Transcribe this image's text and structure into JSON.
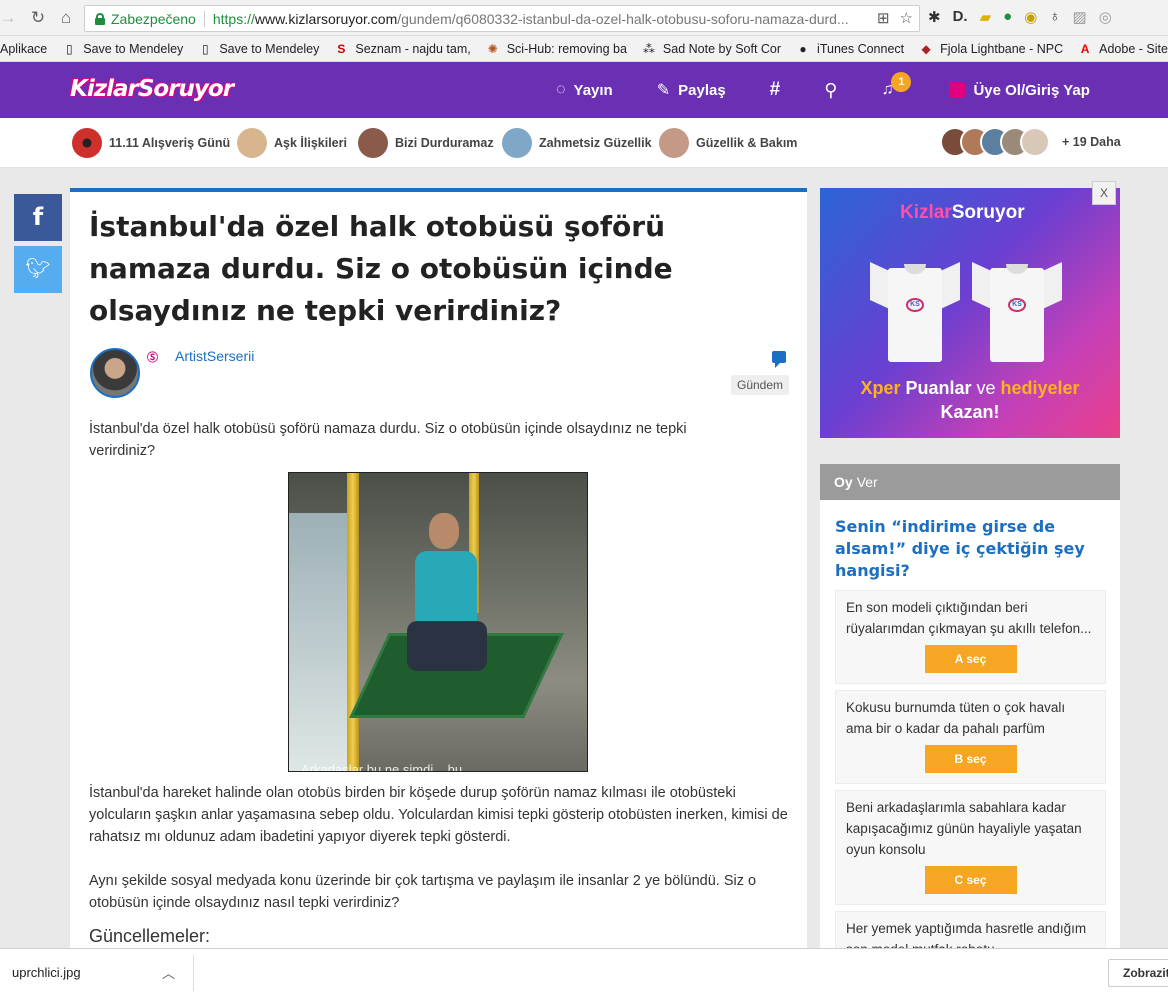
{
  "browser": {
    "secure_label": "Zabezpečeno",
    "url_proto": "https://",
    "url_host": "www.kizlarsoruyor.com",
    "url_path": "/gundem/q6080332-istanbul-da-ozel-halk-otobusu-soforu-namaza-durd..."
  },
  "bookmarks": [
    {
      "label": "Aplikace",
      "icon": "apps-icon"
    },
    {
      "label": "Save to Mendeley",
      "icon": "page-icon"
    },
    {
      "label": "Save to Mendeley",
      "icon": "page-icon"
    },
    {
      "label": "Seznam - najdu tam,",
      "icon": "seznam-icon"
    },
    {
      "label": "Sci-Hub: removing ba",
      "icon": "scihub-icon"
    },
    {
      "label": "Sad Note by Soft Cor",
      "icon": "people-icon"
    },
    {
      "label": "iTunes Connect",
      "icon": "apple-icon"
    },
    {
      "label": "Fjola Lightbane - NPC",
      "icon": "dragon-icon"
    },
    {
      "label": "Adobe - Site Area Te",
      "icon": "adobe-icon"
    }
  ],
  "header": {
    "logo": "KizlarSoruyor",
    "nav": {
      "broadcast": "Yayın",
      "share": "Paylaş",
      "hashtag": "#",
      "notif_count": "1",
      "login": "Üye Ol/Giriş Yap"
    }
  },
  "categories": [
    {
      "label": "11.11 Alışveriş Günü",
      "color": "#d0302b"
    },
    {
      "label": "Aşk İlişkileri",
      "color": "#d7b58f"
    },
    {
      "label": "Bizi Durduramaz",
      "color": "#8a5a4a"
    },
    {
      "label": "Zahmetsiz Güzellik",
      "color": "#7fa7c7"
    },
    {
      "label": "Güzellik & Bakım",
      "color": "#c49a86"
    }
  ],
  "categories_more": "+ 19 Daha",
  "share": {
    "facebook": "f"
  },
  "article": {
    "title": "İstanbul'da özel halk otobüsü şoförü namaza durdu. Siz o otobüsün içinde olsaydınız ne tepki verirdiniz?",
    "author": "ArtistSerserii",
    "category": "Gündem",
    "lead": "İstanbul'da özel halk otobüsü şoförü namaza durdu. Siz o otobüsün içinde olsaydınız ne tepki verirdiniz?",
    "photo_caption": "Arkadaşlar bu ne simdi... bu",
    "p1": "İstanbul'da hareket halinde olan otobüs birden bir köşede durup şoförün namaz kılması ile otobüsteki yolcuların şaşkın anlar yaşamasına sebep oldu. Yolculardan kimisi tepki gösterip otobüsten inerken, kimisi de rahatsız mı oldunuz adam ibadetini yapıyor diyerek tepki gösterdi.",
    "p2": "Aynı şekilde sosyal medyada konu üzerinde bir çok tartışma ve paylaşım ile insanlar 2 ye bölündü. Siz o otobüsün içinde olsaydınız nasıl tepki verirdiniz?",
    "updates_label": "Güncellemeler:"
  },
  "ad": {
    "logo_a": "Kizlar",
    "logo_b": "Soruyor",
    "line1_a": "Xper",
    "line1_b": " Puanlar ",
    "line1_c": "ve",
    "line1_d": " hediyeler",
    "line2": "Kazan!",
    "close": "X"
  },
  "poll": {
    "header_bold": "Oy",
    "header_rest": "Ver",
    "question": "Senin “indirime girse de alsam!” diye iç çektiğin şey hangisi?",
    "options": [
      {
        "text": "En son modeli çıktığından beri rüyalarımdan çıkmayan şu akıllı telefon...",
        "button": "A seç"
      },
      {
        "text": "Kokusu burnumda tüten o çok havalı ama bir o kadar da pahalı parfüm",
        "button": "B seç"
      },
      {
        "text": "Beni arkadaşlarımla sabahlara kadar kapışacağımız günün hayaliyle yaşatan oyun konsolu",
        "button": "C seç"
      },
      {
        "text": "Her yemek yaptığımda hasretle andığım son model mutfak robotu",
        "button": ""
      }
    ]
  },
  "downloads": {
    "file": "uprchlici.jpg",
    "show_all": "Zobrazit"
  },
  "colors": {
    "brand_purple": "#6a2fb2",
    "link_blue": "#1b6ec2",
    "accent_orange": "#f6a623"
  }
}
